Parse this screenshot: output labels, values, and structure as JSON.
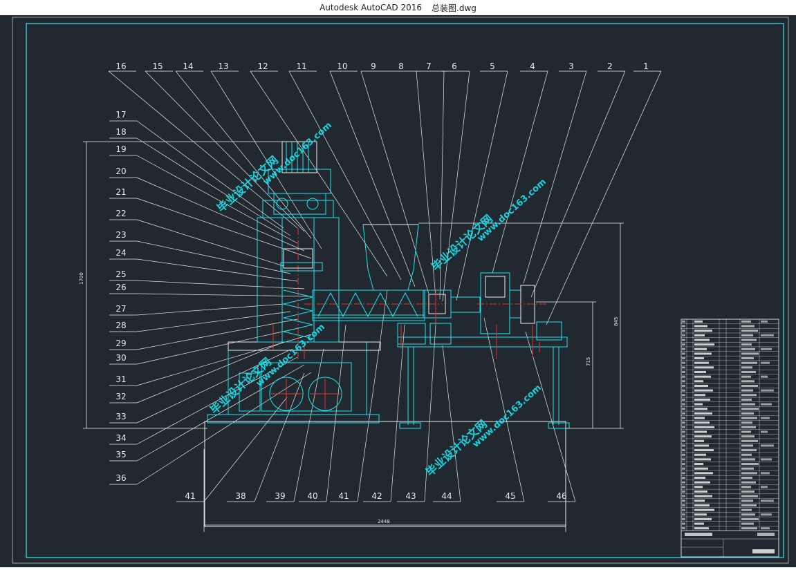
{
  "window": {
    "app_title": "Autodesk AutoCAD 2016",
    "file_name": "总装图.dwg"
  },
  "drawing": {
    "top_labels": [
      "16",
      "15",
      "14",
      "13",
      "12",
      "11",
      "10",
      "9",
      "8",
      "7",
      "6",
      "5",
      "4",
      "3",
      "2",
      "1"
    ],
    "left_labels": [
      "17",
      "18",
      "19",
      "20",
      "21",
      "22",
      "23",
      "24",
      "25",
      "26",
      "27",
      "28",
      "29",
      "30",
      "31",
      "32",
      "33",
      "34",
      "35",
      "36"
    ],
    "bottom_labels": [
      "41",
      "38",
      "39",
      "40",
      "41",
      "42",
      "43",
      "44",
      "45",
      "46"
    ],
    "dimensions": {
      "overall_width": "2448",
      "overall_height": "1700",
      "right_height": "845",
      "inner_height": "715"
    },
    "watermarks": [
      "毕业设计论文网",
      "www.doc163.com"
    ]
  },
  "colors": {
    "background": "#212830",
    "cyan": "#19e6f0",
    "white": "#e8ecec",
    "red": "#e8332f",
    "border": "#2ec4c8"
  }
}
